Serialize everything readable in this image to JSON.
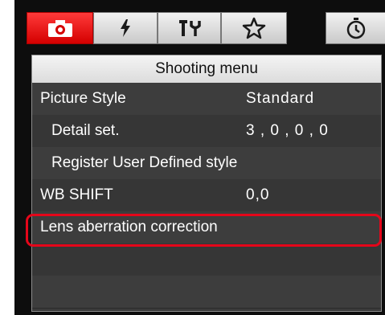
{
  "tabs": [
    {
      "icon": "camera-icon",
      "active": true
    },
    {
      "icon": "lightning-icon",
      "active": false
    },
    {
      "icon": "tools-icon",
      "active": false
    },
    {
      "icon": "star-icon",
      "active": false
    },
    {
      "icon": "timer-icon",
      "active": false
    }
  ],
  "menu": {
    "title": "Shooting menu",
    "items": [
      {
        "label": "Picture Style",
        "value": "Standard"
      },
      {
        "label": "Detail set.",
        "value": "3 , 0 , 0 , 0"
      },
      {
        "label": "Register User Defined style",
        "value": ""
      },
      {
        "label": "WB SHIFT",
        "value": "0,0"
      },
      {
        "label": "Lens aberration correction",
        "value": ""
      }
    ]
  },
  "colors": {
    "active_tab": "#e60000",
    "highlight": "#e5061a"
  }
}
